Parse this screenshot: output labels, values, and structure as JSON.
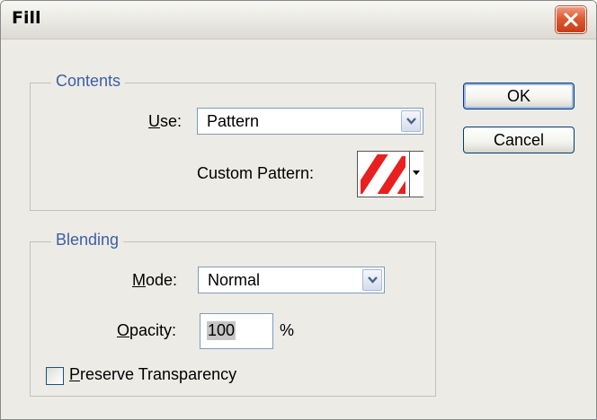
{
  "dialog": {
    "title": "Fill",
    "close_icon": "close-icon"
  },
  "contents": {
    "legend": "Contents",
    "use_label_mnemonic": "U",
    "use_label_rest": "se:",
    "use_value": "Pattern",
    "custom_pattern_label": "Custom Pattern:",
    "pattern_colors": {
      "stripe": "#e8201f",
      "background": "#ffffff"
    }
  },
  "blending": {
    "legend": "Blending",
    "mode_label_mnemonic": "M",
    "mode_label_rest": "ode:",
    "mode_value": "Normal",
    "opacity_label_mnemonic": "O",
    "opacity_label_rest": "pacity:",
    "opacity_value": "100",
    "opacity_unit": "%",
    "preserve_label_mnemonic": "P",
    "preserve_label_rest": "reserve Transparency",
    "preserve_checked": false
  },
  "buttons": {
    "ok": "OK",
    "cancel": "Cancel"
  },
  "colors": {
    "legend_text": "#3c5fa8",
    "dialog_bg": "#ecebe6",
    "close_button": "#dd5a32"
  }
}
